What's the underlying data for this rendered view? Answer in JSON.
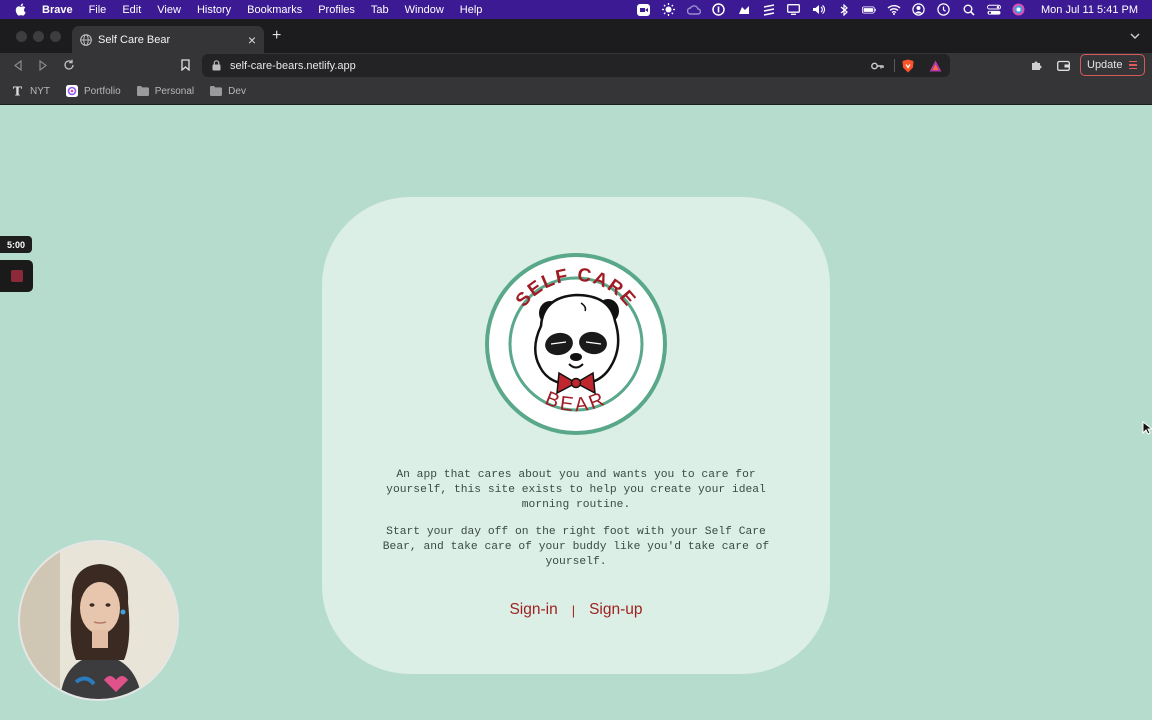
{
  "menubar": {
    "app_name": "Brave",
    "items": [
      "File",
      "Edit",
      "View",
      "History",
      "Bookmarks",
      "Profiles",
      "Tab",
      "Window",
      "Help"
    ],
    "clock": "Mon Jul 11  5:41 PM"
  },
  "browser": {
    "tab_title": "Self Care Bear",
    "url": "self-care-bears.netlify.app",
    "update_label": "Update",
    "bookmarks": [
      "NYT",
      "Portfolio",
      "Personal",
      "Dev"
    ]
  },
  "page": {
    "logo_top_text": "SELF CARE",
    "logo_bottom_text": "BEAR",
    "paragraph_1": "An app that cares about you and wants you to care for yourself, this site exists to help you create your ideal morning routine.",
    "paragraph_2": "Start your day off on the right foot with your Self Care Bear, and take care of your buddy like you'd take care of yourself.",
    "signin_label": "Sign-in",
    "separator": "|",
    "signup_label": "Sign-up"
  },
  "recorder": {
    "timer": "5:00"
  },
  "colors": {
    "page_bg": "#b6dccd",
    "card_bg": "#dcefe6",
    "accent_red": "#9e1f1f",
    "ring_green": "#5aa88a",
    "menubar_bg": "#3b1a93"
  }
}
